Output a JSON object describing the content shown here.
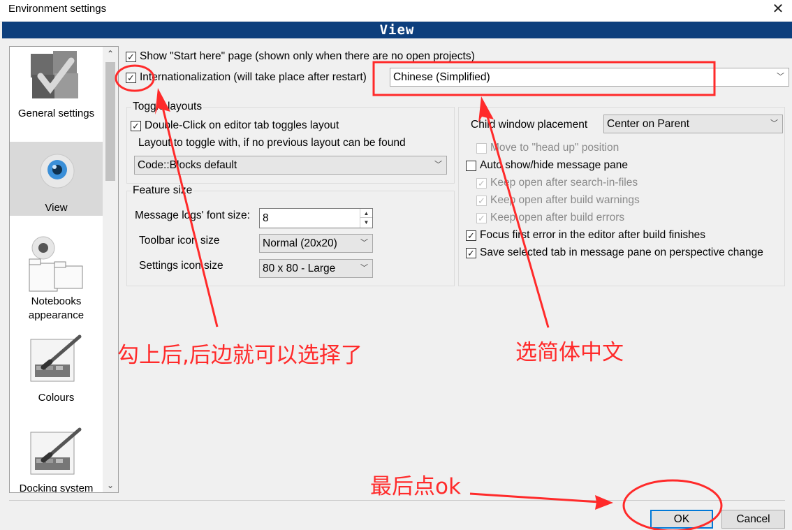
{
  "window": {
    "title": "Environment settings",
    "close_glyph": "✕"
  },
  "header": {
    "title": "View"
  },
  "sidebar": {
    "items": [
      {
        "label": "General settings",
        "icon": "general-settings-icon"
      },
      {
        "label": "View",
        "icon": "view-eye-icon",
        "active": true
      },
      {
        "label": "Notebooks appearance",
        "icon": "notebooks-appearance-icon"
      },
      {
        "label": "Colours",
        "icon": "colours-palette-icon"
      },
      {
        "label": "Docking system",
        "icon": "docking-system-icon"
      }
    ]
  },
  "options": {
    "show_start_here": {
      "label": "Show \"Start here\" page (shown only when there are no open projects)",
      "checked": true
    },
    "internationalization": {
      "label": "Internationalization (will take place after restart)",
      "checked": true,
      "value": "Chinese (Simplified)"
    }
  },
  "toggle_layouts": {
    "title": "Toggle layouts",
    "double_click": {
      "label": "Double-Click on editor tab toggles layout",
      "checked": true
    },
    "layout_label": "Layout to toggle with, if no previous layout can be found",
    "layout_value": "Code::Blocks default"
  },
  "feature_size": {
    "title": "Feature size",
    "font_size_label": "Message logs' font size:",
    "font_size_value": "8",
    "toolbar_icon_label": "Toolbar icon size",
    "toolbar_icon_value": "Normal (20x20)",
    "settings_icon_label": "Settings icon size",
    "settings_icon_value": "80 x 80 - Large"
  },
  "right_panel": {
    "child_window_label": "Child window placement",
    "child_window_value": "Center on Parent",
    "move_head_up": {
      "label": "Move to \"head up\" position",
      "checked": false,
      "enabled": false
    },
    "auto_show_hide": {
      "label": "Auto show/hide message pane",
      "checked": false
    },
    "keep_open_search": {
      "label": "Keep open after search-in-files",
      "checked": true,
      "enabled": false
    },
    "keep_open_warnings": {
      "label": "Keep open after build warnings",
      "checked": true,
      "enabled": false
    },
    "keep_open_errors": {
      "label": "Keep open after build errors",
      "checked": true,
      "enabled": false
    },
    "focus_first_error": {
      "label": "Focus first error in the editor after build finishes",
      "checked": true
    },
    "save_selected_tab": {
      "label": "Save selected tab in message pane on perspective change",
      "checked": true
    }
  },
  "buttons": {
    "ok": "OK",
    "cancel": "Cancel"
  },
  "annotations": {
    "check_then_select": "勾上后,后边就可以选择了",
    "choose_chinese": "选简体中文",
    "finally_ok": "最后点ok"
  },
  "colors": {
    "header_bg": "#0d3f7d",
    "annotation": "#ff2a2a",
    "ok_border": "#0078d7"
  }
}
